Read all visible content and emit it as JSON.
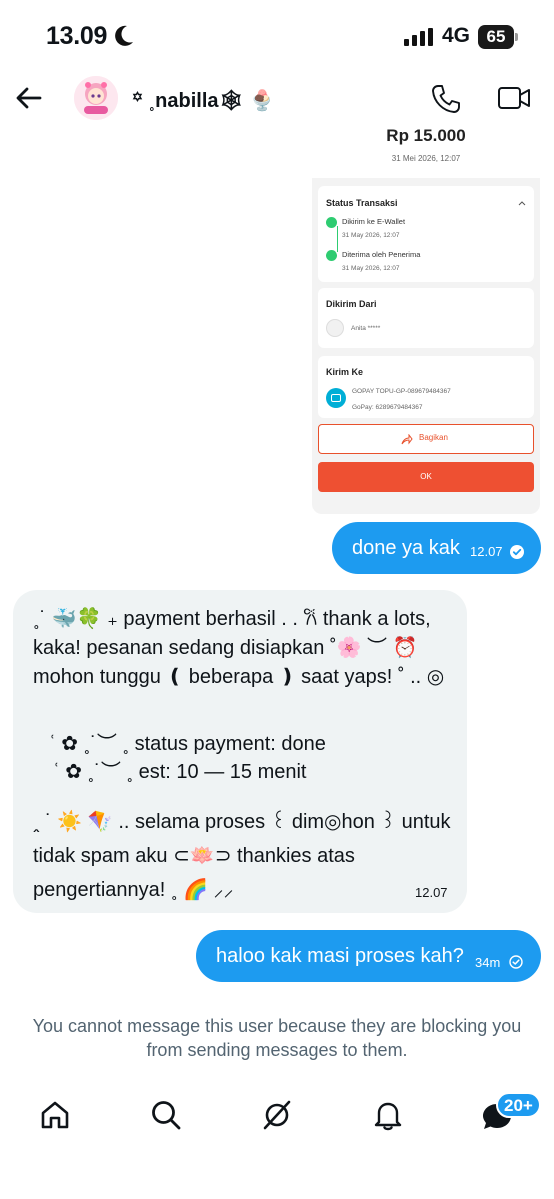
{
  "status_bar": {
    "time": "13.09",
    "network": "4G",
    "battery": "65"
  },
  "header": {
    "display_name": "꙳ ˳nabilla🕸 🍨"
  },
  "shared_image": {
    "amount": "Rp 15.000",
    "date": "31 Mei 2026, 12:07",
    "status_title": "Status Transaksi",
    "steps": [
      {
        "label": "Dikirim ke E-Wallet",
        "time": "31 May 2026, 12:07"
      },
      {
        "label": "Diterima oleh Penerima",
        "time": "31 May 2026, 12:07"
      }
    ],
    "from_title": "Dikirim Dari",
    "from_name": "Anita *****",
    "to_title": "Kirim Ke",
    "to_line1": "GOPAY TOPU-GP-089679484367",
    "to_line2": "GoPay: 6289679484367",
    "share_label": "Bagikan",
    "ok_label": "OK",
    "colors": {
      "accent": "#ee5032",
      "success": "#2ecc71"
    }
  },
  "messages": [
    {
      "direction": "out",
      "text": "done ya kak",
      "time": "12.07",
      "status": "read"
    },
    {
      "direction": "in",
      "lines": [
        "˳˙ 🐳🍀 ₊ payment berhasil . . 𐙚 thank a lots,",
        "kaka! pesanan sedang disiapkan ˚🌸 ︶ ⏰",
        "mohon tunggu ❪ beberapa ❫ saat yaps! ˚ .. ◎",
        "ʿ ✿ ˳˙︶ ˳ status payment: done",
        "ʿ ✿ ˳˙︶ ˳ est: 10 — 15 menit",
        "ꞈ ˙ ☀️ 🪁 .. selama proses ꒰ dim◎hon ꒱ untuk",
        "tidak spam aku ⊂🪷⊃ thankies atas",
        "pengertiannya! ˳ 🌈 ⸝⸝"
      ],
      "time": "12.07"
    },
    {
      "direction": "out",
      "text": "haloo kak masi proses kah?",
      "time": "34m",
      "status": "sent"
    }
  ],
  "blocked_notice": "You cannot message this user because they are blocking you from sending messages to them.",
  "bottom_nav": {
    "items": [
      "home",
      "search",
      "grok",
      "notifications",
      "messages"
    ],
    "messages_badge": "20+"
  },
  "colors": {
    "brand": "#1d9bf0",
    "incoming_bubble": "#eff3f4",
    "muted_text": "#536471"
  }
}
